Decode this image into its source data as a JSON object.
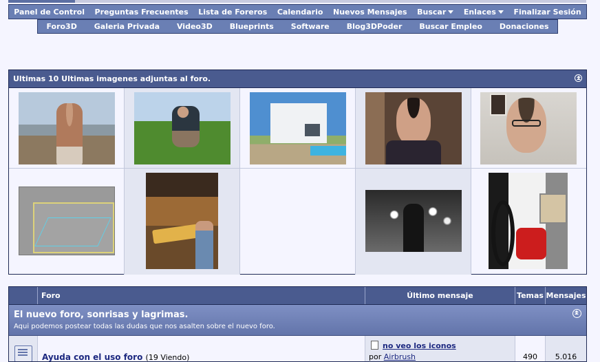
{
  "nav": {
    "main": [
      {
        "label": "Panel de Control"
      },
      {
        "label": "Preguntas Frecuentes"
      },
      {
        "label": "Lista de Foreros"
      },
      {
        "label": "Calendario"
      },
      {
        "label": "Nuevos Mensajes"
      },
      {
        "label": "Buscar",
        "dropdown": true
      },
      {
        "label": "Enlaces",
        "dropdown": true
      },
      {
        "label": "Finalizar Sesión"
      }
    ],
    "sub": [
      {
        "label": "Foro3D"
      },
      {
        "label": "Galeria Privada"
      },
      {
        "label": "Video3D"
      },
      {
        "label": "Blueprints"
      },
      {
        "label": "Software"
      },
      {
        "label": "Blog3DPoder"
      },
      {
        "label": "Buscar Empleo"
      },
      {
        "label": "Donaciones"
      }
    ]
  },
  "gallery": {
    "title": "Ultimas 10 Ultimas imagenes adjuntas al foro."
  },
  "forum_table": {
    "columns": {
      "foro": "Foro",
      "ultimo": "Último mensaje",
      "temas": "Temas",
      "mensajes": "Mensajes"
    },
    "category": {
      "title": "El nuevo foro, sonrisas y lagrimas.",
      "description": "Aqui podemos postear todas las dudas que nos asalten sobre el nuevo foro."
    },
    "rows": [
      {
        "name": "Ayuda con el uso foro",
        "viewing": "(19 Viendo)",
        "last_post_title": "no veo los iconos",
        "last_post_by_prefix": "por",
        "last_post_author": "Airbrush",
        "temas": "490",
        "mensajes": "5.016"
      }
    ]
  },
  "colors": {
    "nav_bg": "#6a7fb4",
    "header_bg": "#4a5b8f",
    "page_bg": "#f5f5ff",
    "link": "#1c2880"
  }
}
